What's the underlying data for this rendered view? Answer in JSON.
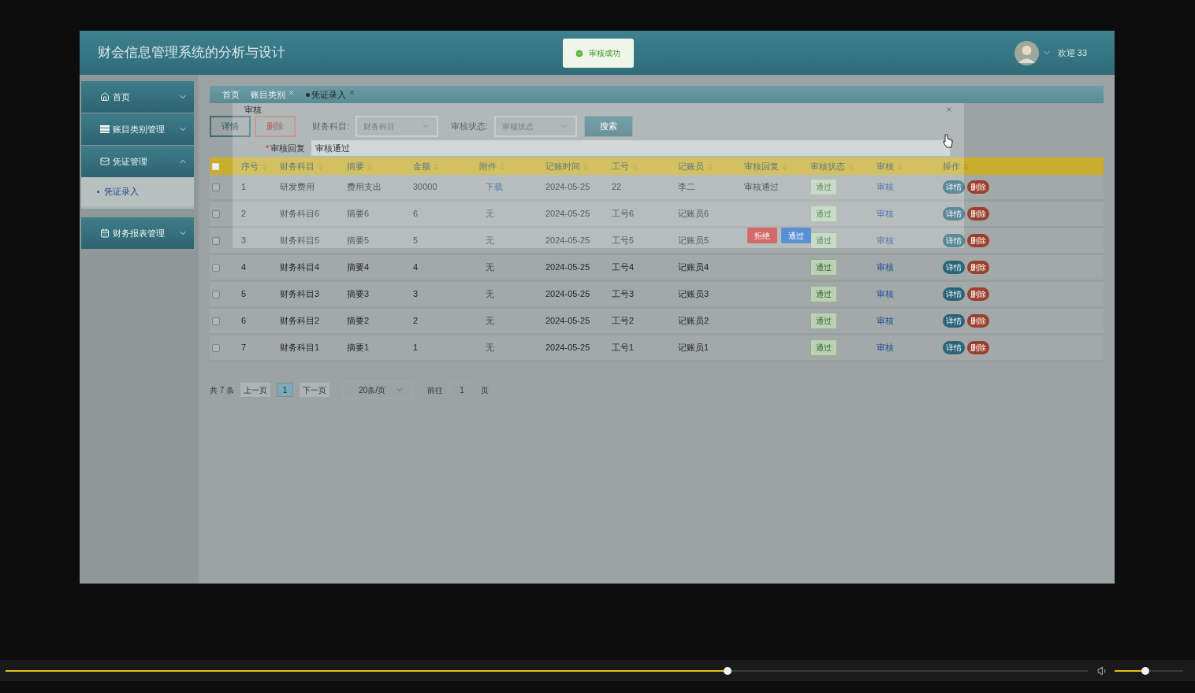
{
  "app": {
    "title": "财会信息管理系统的分析与设计",
    "toast": "审核成功",
    "welcome": "欢迎 33"
  },
  "sidebar": [
    {
      "label": "首页",
      "expanded": false
    },
    {
      "label": "账目类别管理",
      "expanded": false
    },
    {
      "label": "凭证管理",
      "expanded": true,
      "children": [
        {
          "label": "凭证录入",
          "selected": true
        }
      ]
    },
    {
      "label": "财务报表管理",
      "expanded": false
    }
  ],
  "tabs": [
    {
      "label": "首页",
      "closable": false,
      "selected": false
    },
    {
      "label": "账目类别",
      "closable": true,
      "selected": false
    },
    {
      "label": "凭证录入",
      "closable": true,
      "selected": true
    }
  ],
  "toolbar": {
    "buttons": [
      {
        "label": "详情",
        "kind": "detail"
      },
      {
        "label": "删除",
        "kind": "delete"
      }
    ],
    "filters": [
      {
        "label": "财务科目:",
        "placeholder": "财务科目"
      },
      {
        "label": "审核状态:",
        "placeholder": "审核状态"
      }
    ],
    "search": "搜索"
  },
  "table": {
    "header_checked": false,
    "columns": [
      "序号",
      "财务科目",
      "摘要",
      "金额",
      "附件",
      "记账时间",
      "工号",
      "记账员",
      "审核回复",
      "审核状态",
      "审核",
      "操作"
    ],
    "rows": [
      {
        "checked": false,
        "no": "1",
        "subject": "研发费用",
        "summary": "费用支出",
        "amount": "30000",
        "attachment": {
          "label": "下载",
          "kind": "link"
        },
        "date": "2024-05-25",
        "staff_no": "22",
        "clerk": "李二",
        "reply": "审核通过",
        "status": "通过",
        "review": "审核",
        "actions": [
          "详情",
          "删除"
        ]
      },
      {
        "checked": false,
        "no": "2",
        "subject": "财务科目6",
        "summary": "摘要6",
        "amount": "6",
        "attachment": {
          "label": "无",
          "kind": "none"
        },
        "date": "2024-05-25",
        "staff_no": "工号6",
        "clerk": "记账员6",
        "status": "通过",
        "review": "审核",
        "actions": [
          "详情",
          "删除"
        ]
      },
      {
        "checked": false,
        "no": "3",
        "subject": "财务科目5",
        "summary": "摘要5",
        "amount": "5",
        "attachment": {
          "label": "无",
          "kind": "none"
        },
        "date": "2024-05-25",
        "staff_no": "工号5",
        "clerk": "记账员5",
        "status": "通过",
        "review": "审核",
        "actions": [
          "详情",
          "删除"
        ]
      },
      {
        "checked": false,
        "no": "4",
        "subject": "财务科目4",
        "summary": "摘要4",
        "amount": "4",
        "attachment": {
          "label": "无",
          "kind": "none"
        },
        "date": "2024-05-25",
        "staff_no": "工号4",
        "clerk": "记账员4",
        "status": "通过",
        "review": "审核",
        "actions": [
          "详情",
          "删除"
        ]
      },
      {
        "checked": false,
        "no": "5",
        "subject": "财务科目3",
        "summary": "摘要3",
        "amount": "3",
        "attachment": {
          "label": "无",
          "kind": "none"
        },
        "date": "2024-05-25",
        "staff_no": "工号3",
        "clerk": "记账员3",
        "status": "通过",
        "review": "审核",
        "actions": [
          "详情",
          "删除"
        ]
      },
      {
        "checked": false,
        "no": "6",
        "subject": "财务科目2",
        "summary": "摘要2",
        "amount": "2",
        "attachment": {
          "label": "无",
          "kind": "none"
        },
        "date": "2024-05-25",
        "staff_no": "工号2",
        "clerk": "记账员2",
        "status": "通过",
        "review": "审核",
        "actions": [
          "详情",
          "删除"
        ]
      },
      {
        "checked": false,
        "no": "7",
        "subject": "财务科目1",
        "summary": "摘要1",
        "amount": "1",
        "attachment": {
          "label": "无",
          "kind": "none"
        },
        "date": "2024-05-25",
        "staff_no": "工号1",
        "clerk": "记账员1",
        "status": "通过",
        "review": "审核",
        "actions": [
          "详情",
          "删除"
        ]
      }
    ]
  },
  "pagination": {
    "total": "共 7 条",
    "prev": "上一页",
    "pages": [
      {
        "label": "1",
        "selected": true
      }
    ],
    "next": "下一页",
    "page_size": "20条/页",
    "goto_label": "前往",
    "goto_value": "1",
    "goto_suffix": "页"
  },
  "dialog": {
    "title": "审核",
    "required_mark": "*",
    "field_label": "审核回复",
    "field_value": "审核通过",
    "buttons": [
      {
        "label": "拒绝",
        "kind": "danger"
      },
      {
        "label": "通过",
        "kind": "primary"
      }
    ]
  },
  "player": {
    "progress": {
      "level": 0.667
    },
    "volume": {
      "level": 0.45
    }
  }
}
